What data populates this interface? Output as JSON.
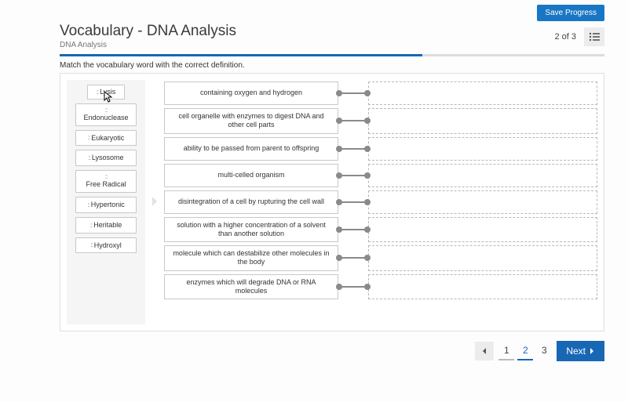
{
  "topbar": {
    "save_label": "Save Progress"
  },
  "header": {
    "title": "Vocabulary - DNA Analysis",
    "subtitle": "DNA Analysis",
    "counter": "2 of 3"
  },
  "instruction": "Match the vocabulary word with the correct definition.",
  "words": [
    {
      "label": "Lysis",
      "dragging": true,
      "twoline": false
    },
    {
      "label": "Endonuclease",
      "dragging": false,
      "twoline": true
    },
    {
      "label": "Eukaryotic",
      "dragging": false,
      "twoline": false
    },
    {
      "label": "Lysosome",
      "dragging": false,
      "twoline": false
    },
    {
      "label": "Free Radical",
      "dragging": false,
      "twoline": true
    },
    {
      "label": "Hypertonic",
      "dragging": false,
      "twoline": false
    },
    {
      "label": "Heritable",
      "dragging": false,
      "twoline": false
    },
    {
      "label": "Hydroxyl",
      "dragging": false,
      "twoline": false
    }
  ],
  "definitions": [
    "containing oxygen and hydrogen",
    "cell organelle with enzymes to digest DNA and other cell parts",
    "ability to be passed from parent to offspring",
    "multi-celled organism",
    "disintegration of a cell by rupturing the cell wall",
    "solution with a higher concentration of a solvent than another solution",
    "molecule which can destabilize other molecules in the body",
    "enzymes which will degrade DNA or RNA molecules"
  ],
  "footer": {
    "pages": [
      "1",
      "2",
      "3"
    ],
    "current_page": 2,
    "next_label": "Next"
  }
}
